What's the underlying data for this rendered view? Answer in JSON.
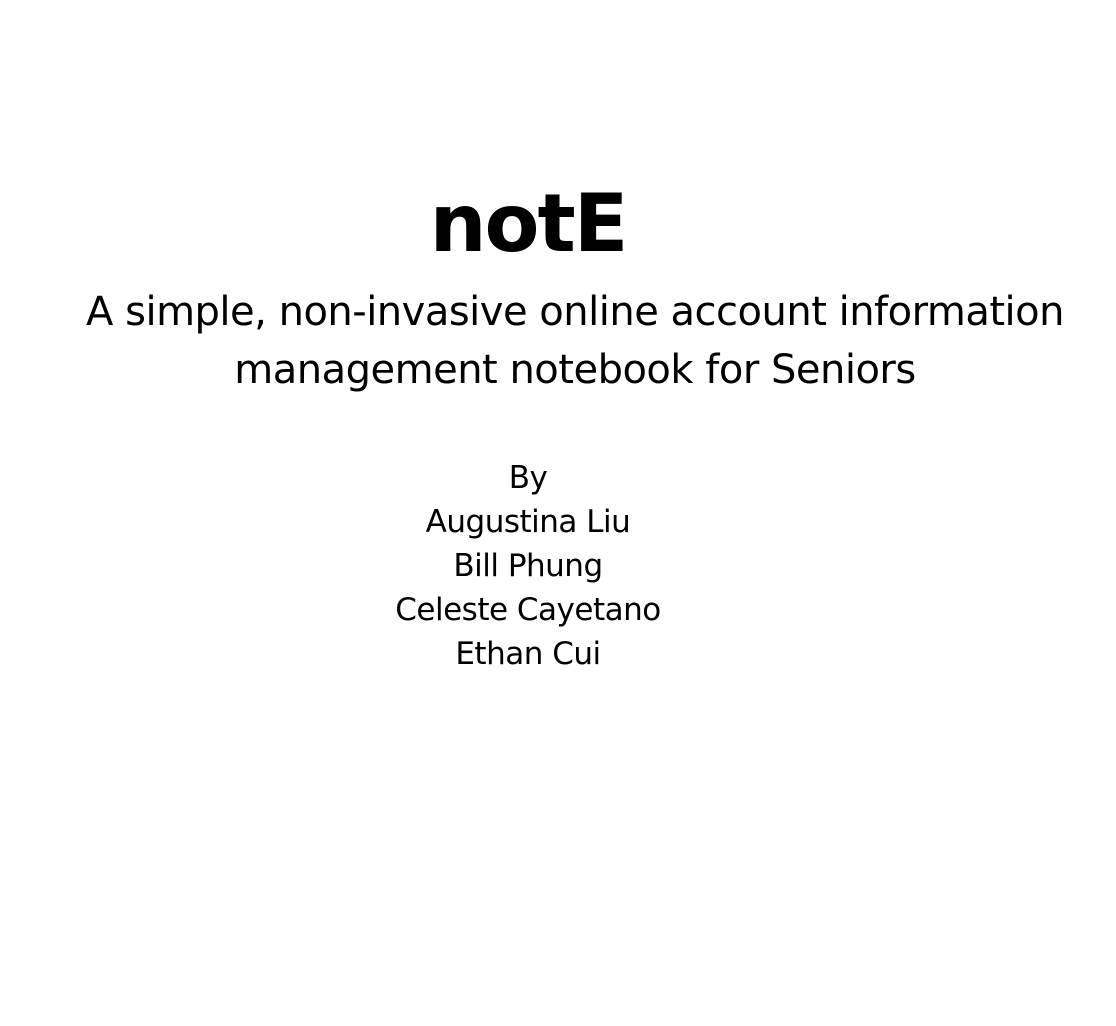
{
  "document": {
    "title": "notE",
    "subtitle_line1": "A simple, non-invasive online account information",
    "subtitle_line2": "management notebook for Seniors",
    "by_label": "By",
    "authors": [
      "Augustina Liu",
      "Bill Phung",
      "Celeste Cayetano",
      "Ethan Cui"
    ]
  }
}
